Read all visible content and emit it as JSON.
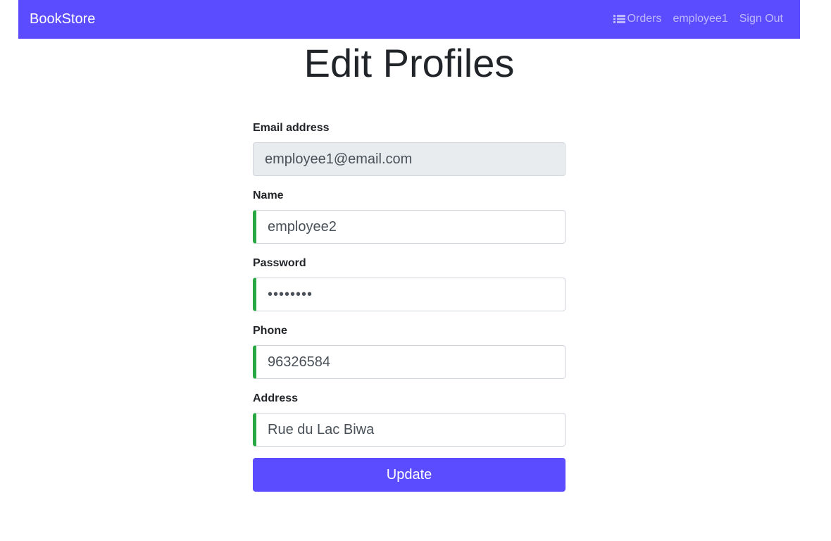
{
  "navbar": {
    "brand": "BookStore",
    "links": [
      {
        "label": "Orders",
        "icon": "list-icon"
      },
      {
        "label": "employee1"
      },
      {
        "label": "Sign Out"
      }
    ],
    "background": "#5b4cff"
  },
  "page": {
    "title": "Edit Profiles"
  },
  "form": {
    "email": {
      "label": "Email address",
      "value": "employee1@email.com"
    },
    "name": {
      "label": "Name",
      "value": "employee2"
    },
    "password": {
      "label": "Password",
      "value": "password"
    },
    "phone": {
      "label": "Phone",
      "value": "96326584"
    },
    "address": {
      "label": "Address",
      "value": "Rue du Lac Biwa"
    },
    "submit_label": "Update"
  },
  "colors": {
    "accent": "#5b4cff",
    "valid_border": "#28a745",
    "readonly_bg": "#e9ecef"
  }
}
